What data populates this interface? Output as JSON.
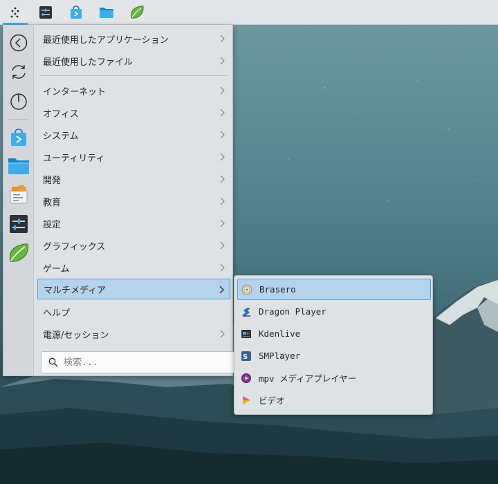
{
  "panel": {
    "items": [
      {
        "icon": "kickoff-dots-icon"
      },
      {
        "icon": "settings-sliders-icon"
      },
      {
        "icon": "discover-store-icon"
      },
      {
        "icon": "file-manager-folder-icon"
      },
      {
        "icon": "leaf-app-icon"
      }
    ]
  },
  "favorites": [
    {
      "icon": "back-arrow-icon"
    },
    {
      "icon": "refresh-icon"
    },
    {
      "icon": "power-icon"
    },
    {
      "icon": "discover-store-icon"
    },
    {
      "icon": "file-manager-folder-icon"
    },
    {
      "icon": "kate-editor-icon"
    },
    {
      "icon": "system-settings-icon"
    },
    {
      "icon": "leaf-app-icon"
    }
  ],
  "menu": {
    "items": [
      {
        "label": "最近使用したアプリケーション"
      },
      {
        "label": "最近使用したファイル"
      },
      {
        "label": "インターネット"
      },
      {
        "label": "オフィス"
      },
      {
        "label": "システム"
      },
      {
        "label": "ユーティリティ"
      },
      {
        "label": "開発"
      },
      {
        "label": "教育"
      },
      {
        "label": "設定"
      },
      {
        "label": "グラフィックス"
      },
      {
        "label": "ゲーム"
      },
      {
        "label": "マルチメディア"
      },
      {
        "label": "ヘルプ"
      },
      {
        "label": "電源/セッション"
      }
    ]
  },
  "search": {
    "placeholder": "検索..."
  },
  "submenu": {
    "items": [
      {
        "label": "Brasero",
        "icon": "brasero-disc-icon"
      },
      {
        "label": "Dragon Player",
        "icon": "dragon-player-icon"
      },
      {
        "label": "Kdenlive",
        "icon": "kdenlive-icon"
      },
      {
        "label": "SMPlayer",
        "icon": "smplayer-icon"
      },
      {
        "label": "mpv メディアプレイヤー",
        "icon": "mpv-icon"
      },
      {
        "label": "ビデオ",
        "icon": "video-icon"
      }
    ]
  },
  "colors": {
    "accent": "#3daee9",
    "selection": "#b4d3ec",
    "menu_bg": "#dfe2e5",
    "panel_bg": "#e3e6e9"
  }
}
